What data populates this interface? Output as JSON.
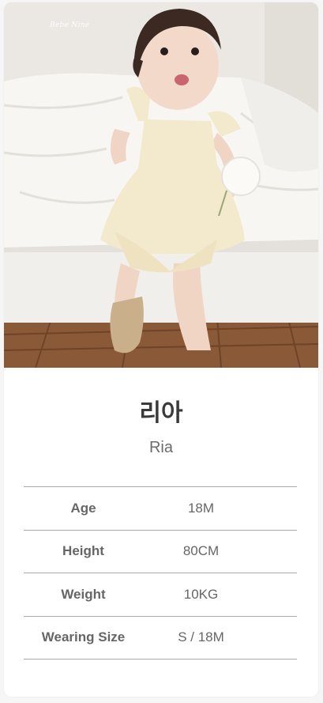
{
  "photo": {
    "watermark": "Bebe Nine",
    "alt": "child model photo"
  },
  "profile": {
    "name_korean": "리아",
    "name_english": "Ria"
  },
  "specs": [
    {
      "label": "Age",
      "value": "18M"
    },
    {
      "label": "Height",
      "value": "80CM"
    },
    {
      "label": "Weight",
      "value": "10KG"
    },
    {
      "label": "Wearing Size",
      "value": "S / 18M"
    }
  ],
  "colors": {
    "divider": "#a8a8a8",
    "text_dark": "#3a3a3a",
    "text_muted": "#666666",
    "card_bg": "#ffffff"
  }
}
